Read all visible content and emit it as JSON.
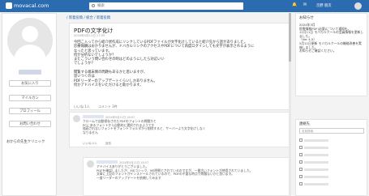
{
  "header": {
    "logo_text": "movacal.com",
    "search_placeholder": "検索",
    "user_name": "京野 朋次",
    "brand_color": "#2b6cb0"
  },
  "left": {
    "buttons": [
      "お気に入り",
      "マイルカン",
      "プロフィール",
      "お問い合わせ"
    ],
    "clinic_label": "おからの先生クリニック"
  },
  "breadcrumb": "/ 新着投稿 / 総合 / 新着投稿",
  "post": {
    "title": "PDFの文字化け",
    "meta": "2024年5月11日 17:05",
    "body": "今回こ入ってから紹介状作成にリンクしているPDFファイルが文字化けしていると紹介先から話がありました。\n診療報酬はおかりませんが、ドバカルリンクのアクセスやPDFについて再度ログインしても文字が表示されるように\nなったと思っています。\n何が分析ないでしょうか？\nまたこういう問い合わせの時はどのようにしたら対応いい\nでしょうか？\n\n閲覧する端末側の問題もあるかと思いますが、\n思いつくのは\nPDFリーダーのアップデートくらいしかありません。\n何かアドバイスをいただけると助かります。",
    "likes": "いいね 1人",
    "comments": "コメント 3件"
  },
  "comments": [
    {
      "date": "2024年5月11日 18:07",
      "text": "クロームで自動保存されたPDFのフォントの問題かと\nPCにあるフォントから自動的に選択されるようです\n描画されないフォントをフォントフォルダから削除すると、サーバーより文字化けしなく\nなりません",
      "likes": "いいね 0人",
      "reply": "返信"
    },
    {
      "date": "2024年5月11日 18:57",
      "text": "アドバイスありがとうございました。\nPDFを確認しましたが、MSゴシック、MS明朝とされているのですが、一番古いフォントが使用されていました。\n文章に上記のフォントがインストールされているので、PDFの不要な時点で問題ないかと思います。\n一度リーダーのアップデートを依頼してみます",
      "likes": "いいね 0人",
      "reply": "返信"
    }
  ],
  "notice": {
    "heading": "お知らせ",
    "text": "2024年3月\n医療情報PDF(必要)について通知を。\n11月11日 モバカルクールの会員情報を更新しました。\n（Ver 4.5）\n5月11日更新 モバカルクールの機能改善を実施しました。\nお知らせご確認ください。"
  },
  "contacts": {
    "heading": "連絡先",
    "search_placeholder": "名前検索"
  }
}
